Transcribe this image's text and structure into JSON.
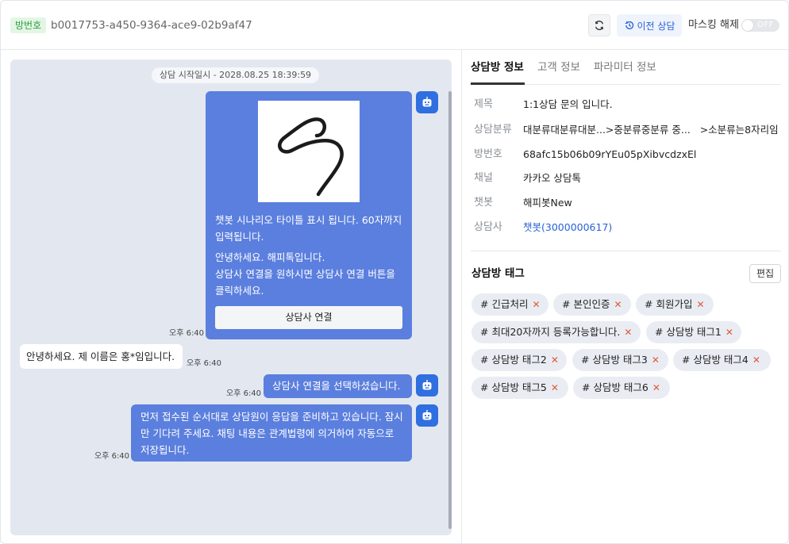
{
  "header": {
    "room_badge": "방번호",
    "room_id": "b0017753-a450-9364-ace9-02b9af47",
    "refresh_icon": "refresh-icon",
    "prev_consult_label": "이전 상담",
    "prev_consult_icon": "history-icon",
    "masking_label": "마스킹 해제",
    "masking_toggle_text": "OFF",
    "masking_on": false
  },
  "chat": {
    "start_label": "상담 시작일시 - 2028.08.25 18:39:59",
    "messages": [
      {
        "sender": "bot",
        "title": "챗봇 시나리오 타이틀 표시 됩니다. 60자까지 입력됩니다.",
        "body": "안녕하세요. 해피톡입니다.\n상담사 연결을 원하시면 상담사 연결 버튼을 클릭하세요.",
        "button": "상담사 연결",
        "time": "오후 6:40"
      },
      {
        "sender": "user",
        "text": "안녕하세요. 제 이름은 홍*임입니다.",
        "time": "오후 6:40"
      },
      {
        "sender": "bot",
        "text": "상담사 연결을 선택하셨습니다.",
        "time": "오후 6:40"
      },
      {
        "sender": "bot",
        "text": "먼저 접수된 순서대로 상담원이 응답을 준비하고 있습니다. 잠시만 기다려 주세요. 채팅 내용은 관계법령에 의거하여 자동으로 저장됩니다.",
        "time": "오후 6:40"
      }
    ]
  },
  "tabs": [
    "상담방 정보",
    "고객 정보",
    "파라미터 정보"
  ],
  "info": [
    {
      "label": "제목",
      "value": "1:1상담 문의 입니다."
    },
    {
      "label": "상담분류",
      "value": "대분류대분류대분...>중분류중분류 중...   >소분류는8자리임"
    },
    {
      "label": "방번호",
      "value": "68afc15b06b09rYEu05pXibvcdzxEl"
    },
    {
      "label": "채널",
      "value": "카카오 상담톡"
    },
    {
      "label": "챗봇",
      "value": "해피봇New"
    },
    {
      "label": "상담사",
      "value": "챗봇(3000000617)"
    }
  ],
  "tags_section": {
    "title": "상담방 태그",
    "edit_label": "편집",
    "remove_symbol": "✕",
    "tags": [
      "# 긴급처리",
      "# 본인인증",
      "# 회원가입",
      "# 최대20자까지 등록가능합니다.",
      "# 상담방 태그1",
      "# 상담방 태그2",
      "# 상담방 태그3",
      "# 상담방 태그4",
      "# 상담방 태그5",
      "# 상담방 태그6"
    ]
  },
  "colors": {
    "accent": "#2f6fe0",
    "bot_bubble": "#5b7fde",
    "chat_bg": "#e3e8f0",
    "badge_green": "#2e9c45",
    "tag_remove": "#e05a3a"
  }
}
